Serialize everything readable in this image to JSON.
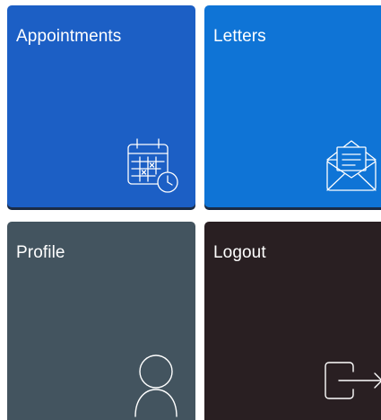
{
  "tiles": [
    {
      "label": "Appointments",
      "icon": "calendar-clock-icon",
      "color": "#1c5fc5"
    },
    {
      "label": "Letters",
      "icon": "letter-envelope-icon",
      "color": "#0f74d6"
    },
    {
      "label": "Profile",
      "icon": "user-icon",
      "color": "#43545f"
    },
    {
      "label": "Logout",
      "icon": "logout-icon",
      "color": "#291f22"
    }
  ]
}
